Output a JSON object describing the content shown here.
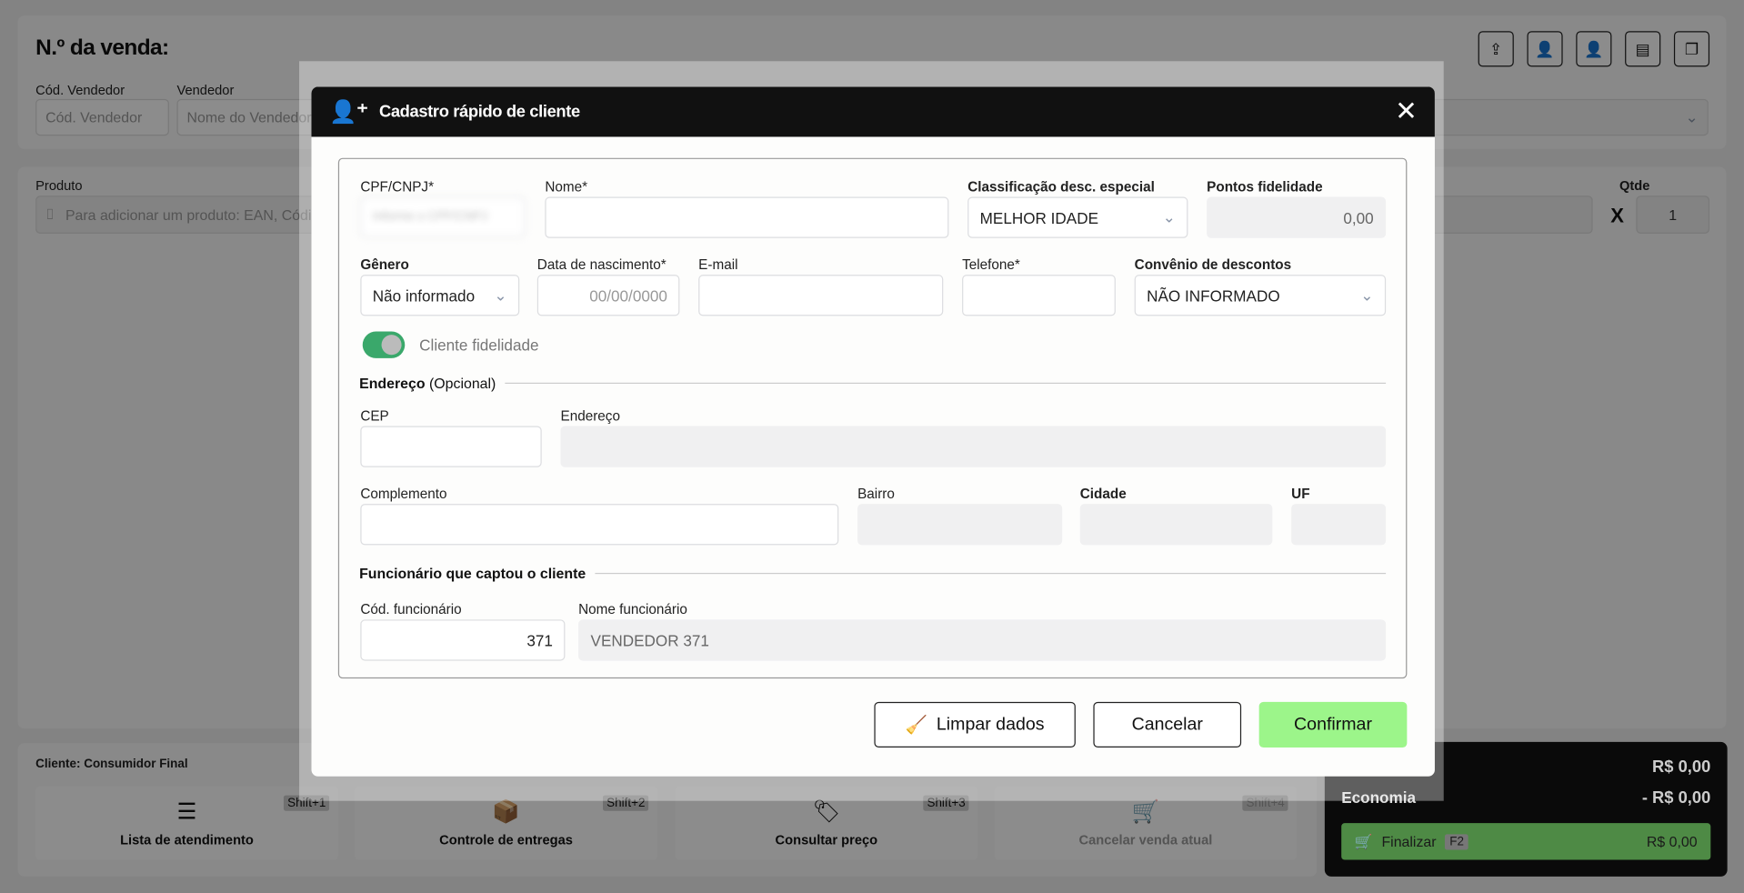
{
  "page": {
    "title": "N.º da venda:",
    "seller_code_label": "Cód. Vendedor",
    "seller_code_placeholder": "Cód. Vendedor",
    "seller_label": "Vendedor",
    "seller_placeholder": "Nome do Vendedor",
    "product_label": "Produto",
    "product_placeholder": "Para adicionar um produto: EAN, Código...",
    "qty_label": "Qtde",
    "qty_value": "1",
    "times": "X",
    "toolbar_icons": [
      "share-icon",
      "user-card-icon",
      "add-user-icon",
      "folder-icon",
      "copy-icon"
    ],
    "client_label": "Cliente: Consumidor Final",
    "actions": [
      {
        "label": "Lista de atendimento",
        "shortcut": "Shift+1",
        "icon": "list-icon"
      },
      {
        "label": "Controle de entregas",
        "shortcut": "Shift+2",
        "icon": "delivery-box-icon"
      },
      {
        "label": "Consultar preço",
        "shortcut": "Shift+3",
        "icon": "price-tag-search-icon"
      },
      {
        "label": "Cancelar venda atual",
        "shortcut": "Shift+4",
        "icon": "cart-cancel-icon"
      }
    ],
    "totals": {
      "total": "R$ 0,00",
      "economy_label": "Economia",
      "economy": "- R$ 0,00",
      "finish_label": "Finalizar",
      "finish_key": "F2",
      "finish_value": "R$  0,00"
    }
  },
  "modal": {
    "title": "Cadastro rápido de cliente",
    "cpf_label": "CPF/CNPJ*",
    "cpf_placeholder": "Informe o CPF/CNPJ",
    "name_label": "Nome*",
    "class_label": "Classificação desc. especial",
    "class_value": "MELHOR IDADE",
    "points_label": "Pontos fidelidade",
    "points_value": "0,00",
    "gender_label": "Gênero",
    "gender_value": "Não informado",
    "birth_label": "Data de nascimento*",
    "birth_placeholder": "00/00/0000",
    "email_label": "E-mail",
    "phone_label": "Telefone*",
    "agreement_label": "Convênio de descontos",
    "agreement_value": "NÃO INFORMADO",
    "loyalty_label": "Cliente fidelidade",
    "loyalty_on": true,
    "address_section": "Endereço",
    "address_optional": "(Opcional)",
    "cep_label": "CEP",
    "address_label": "Endereço",
    "complement_label": "Complemento",
    "district_label": "Bairro",
    "city_label": "Cidade",
    "uf_label": "UF",
    "employee_section": "Funcionário que captou o cliente",
    "emp_code_label": "Cód. funcionário",
    "emp_code_value": "371",
    "emp_name_label": "Nome funcionário",
    "emp_name_value": "VENDEDOR 371",
    "clear_label": "Limpar dados",
    "cancel_label": "Cancelar",
    "confirm_label": "Confirmar",
    "confirm_color": "#9cf58a",
    "toggle_color": "#3aa86b"
  }
}
